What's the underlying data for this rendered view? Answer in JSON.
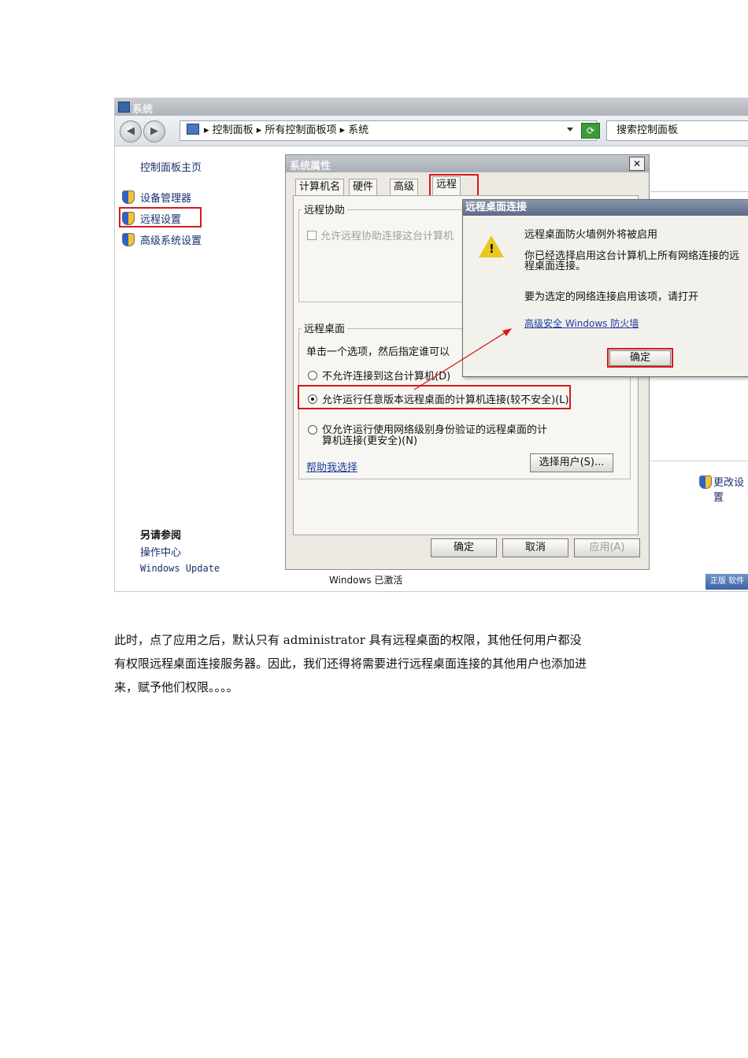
{
  "window": {
    "title": "系统",
    "address": "▸ 控制面板 ▸ 所有控制面板项 ▸ 系统",
    "search_placeholder": "搜索控制面板"
  },
  "sidebar": {
    "home": "控制面板主页",
    "items": [
      {
        "label": "设备管理器"
      },
      {
        "label": "远程设置"
      },
      {
        "label": "高级系统设置"
      }
    ],
    "see_also_title": "另请参阅",
    "see_also": [
      "操作中心",
      "Windows Update"
    ]
  },
  "dialog": {
    "title": "系统属性",
    "tabs": [
      "计算机名",
      "硬件",
      "高级",
      "远程"
    ],
    "assist_group": "远程协助",
    "assist_checkbox": "允许远程协助连接这台计算机",
    "desktop_group": "远程桌面",
    "desktop_instruction": "单击一个选项，然后指定谁可以",
    "option1": "不允许连接到这台计算机(D)",
    "option2": "允许运行任意版本远程桌面的计算机连接(较不安全)(L)",
    "option3_line1": "仅允许运行使用网络级别身份验证的远程桌面的计",
    "option3_line2": "算机连接(更安全)(N)",
    "help_link": "帮助我选择",
    "select_users": "选择用户(S)...",
    "ok": "确定",
    "cancel": "取消",
    "apply": "应用(A)"
  },
  "popup": {
    "title": "远程桌面连接",
    "line1": "远程桌面防火墙例外将被启用",
    "line2a": "你已经选择启用这台计算机上所有网络连接的远",
    "line2b": "程桌面连接。",
    "line3": "要为选定的网络连接启用该项，请打开",
    "link": "高级安全 Windows 防火墙",
    "ok": "确定"
  },
  "background": {
    "change_settings": "更改设置",
    "activation": "Windows 已激活",
    "genuine_badge": "正版 软件"
  },
  "body_text": {
    "line1": "此时，点了应用之后，默认只有 administrator 具有远程桌面的权限，其他任何用户都没",
    "line2": "有权限远程桌面连接服务器。因此，我们还得将需要进行远程桌面连接的其他用户也添加进",
    "line3": "来，赋予他们权限。。。。"
  },
  "colors": {
    "highlight_red": "#d41a1a",
    "link_blue": "#1e3d9f"
  }
}
